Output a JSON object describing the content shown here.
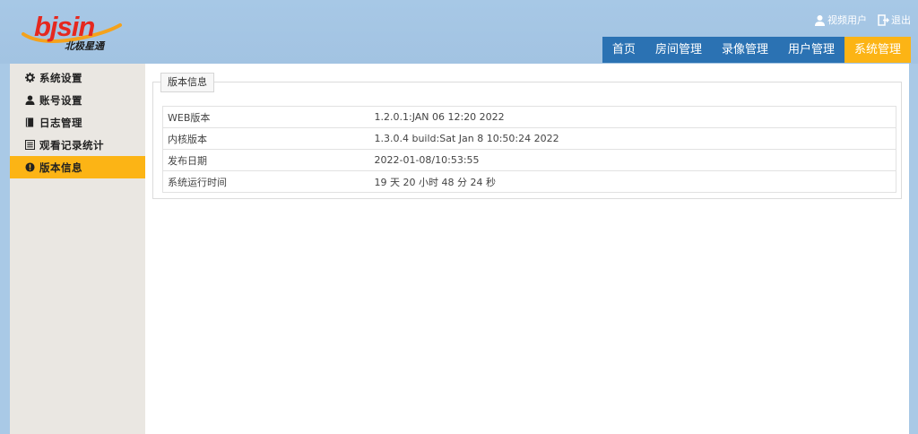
{
  "logo": {
    "brand": "bjsin",
    "tagline": "北极星通",
    "colors": {
      "wordmark": "#e5281f",
      "swoosh": "#f4a21c"
    }
  },
  "user_links": [
    {
      "label": "视频用户",
      "icon": "user-icon"
    },
    {
      "label": "退出",
      "icon": "logout-icon"
    }
  ],
  "nav": {
    "items": [
      {
        "label": "首页",
        "active": false
      },
      {
        "label": "房间管理",
        "active": false
      },
      {
        "label": "录像管理",
        "active": false
      },
      {
        "label": "用户管理",
        "active": false
      },
      {
        "label": "系统管理",
        "active": true
      }
    ],
    "colors": {
      "default": "#2b72b3",
      "active": "#fcb415"
    }
  },
  "sidebar": {
    "items": [
      {
        "label": "系统设置",
        "icon": "gear-icon",
        "active": false
      },
      {
        "label": "账号设置",
        "icon": "user-icon",
        "active": false
      },
      {
        "label": "日志管理",
        "icon": "book-icon",
        "active": false
      },
      {
        "label": "观看记录统计",
        "icon": "list-icon",
        "active": false
      },
      {
        "label": "版本信息",
        "icon": "info-icon",
        "active": true
      }
    ]
  },
  "panel": {
    "title": "版本信息",
    "rows": [
      {
        "label": "WEB版本",
        "value": "1.2.0.1:JAN 06 12:20 2022"
      },
      {
        "label": "内核版本",
        "value": "1.3.0.4 build:Sat Jan 8 10:50:24 2022"
      },
      {
        "label": "发布日期",
        "value": "2022-01-08/10:53:55"
      },
      {
        "label": "系统运行时间",
        "value": "19 天 20 小时 48 分 24 秒"
      }
    ]
  }
}
